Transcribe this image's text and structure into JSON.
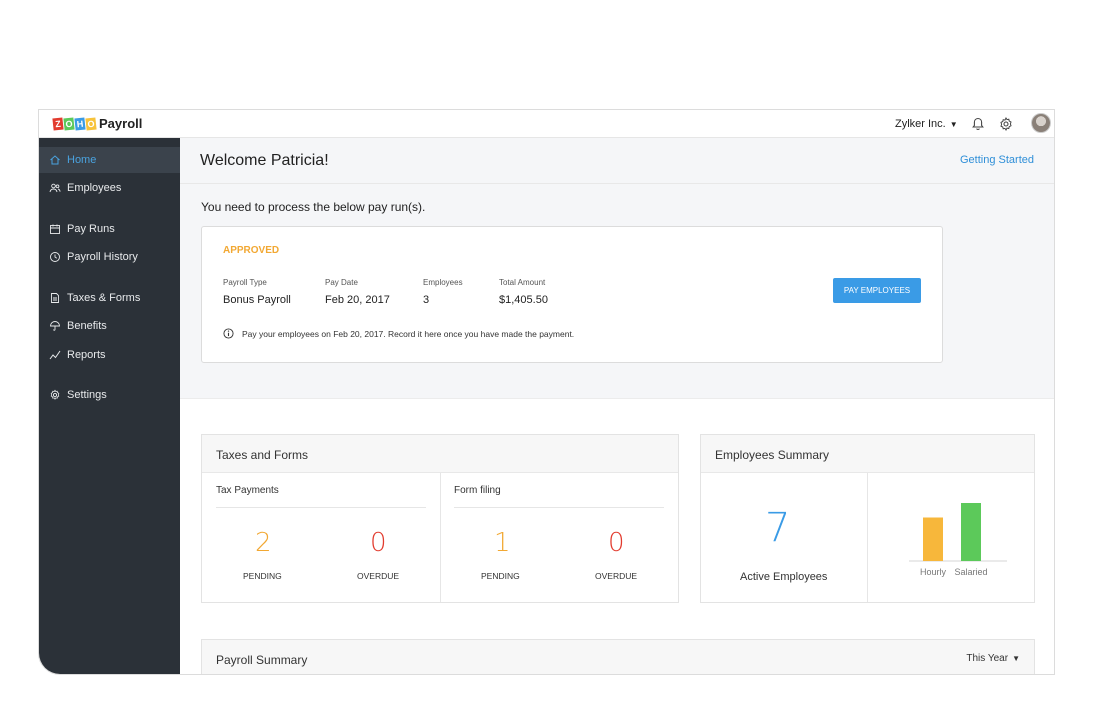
{
  "header": {
    "logo_letters": [
      "Z",
      "O",
      "H",
      "O"
    ],
    "app_name": "Payroll",
    "org_name": "Zylker Inc.",
    "icons": [
      "bell-icon",
      "gear-icon",
      "user-avatar"
    ]
  },
  "sidebar": {
    "items": [
      {
        "label": "Home",
        "icon": "home-icon",
        "active": true
      },
      {
        "label": "Employees",
        "icon": "users-icon"
      },
      {
        "label": "Pay Runs",
        "icon": "calendar-icon"
      },
      {
        "label": "Payroll History",
        "icon": "clock-icon"
      },
      {
        "label": "Taxes & Forms",
        "icon": "document-icon"
      },
      {
        "label": "Benefits",
        "icon": "umbrella-icon"
      },
      {
        "label": "Reports",
        "icon": "chart-line-icon"
      },
      {
        "label": "Settings",
        "icon": "gear-icon"
      }
    ]
  },
  "main": {
    "welcome": "Welcome Patricia!",
    "getting_started": "Getting Started",
    "process_text": "You need to process the below pay run(s).",
    "payrun": {
      "status": "APPROVED",
      "fields": [
        {
          "label": "Payroll Type",
          "value": "Bonus Payroll"
        },
        {
          "label": "Pay Date",
          "value": "Feb 20, 2017"
        },
        {
          "label": "Employees",
          "value": "3"
        },
        {
          "label": "Total Amount",
          "value": "$1,405.50"
        }
      ],
      "button": "PAY EMPLOYEES",
      "note": "Pay your employees on Feb 20, 2017. Record it here once you have made the payment."
    },
    "taxes_forms": {
      "title": "Taxes and Forms",
      "tax_payments": {
        "title": "Tax Payments",
        "pending": "2",
        "pending_label": "PENDING",
        "overdue": "0",
        "overdue_label": "OVERDUE"
      },
      "form_filing": {
        "title": "Form filing",
        "pending": "1",
        "pending_label": "PENDING",
        "overdue": "0",
        "overdue_label": "OVERDUE"
      }
    },
    "employees_summary": {
      "title": "Employees Summary",
      "active_count": "7",
      "active_label": "Active Employees"
    },
    "payroll_summary": {
      "title": "Payroll Summary",
      "period": "This Year"
    }
  },
  "colors": {
    "accent": "#3a9be6",
    "approved": "#f2a833",
    "pending": "#f2a833",
    "overdue": "#e23b2e",
    "hourly": "#f7b73b",
    "salaried": "#5cc95a",
    "sidebar": "#2b3138"
  },
  "chart_data": {
    "type": "bar",
    "categories": [
      "Hourly",
      "Salaried"
    ],
    "values": [
      3,
      4
    ],
    "ylim": [
      0,
      4
    ],
    "colors": [
      "#f7b73b",
      "#5cc95a"
    ]
  }
}
